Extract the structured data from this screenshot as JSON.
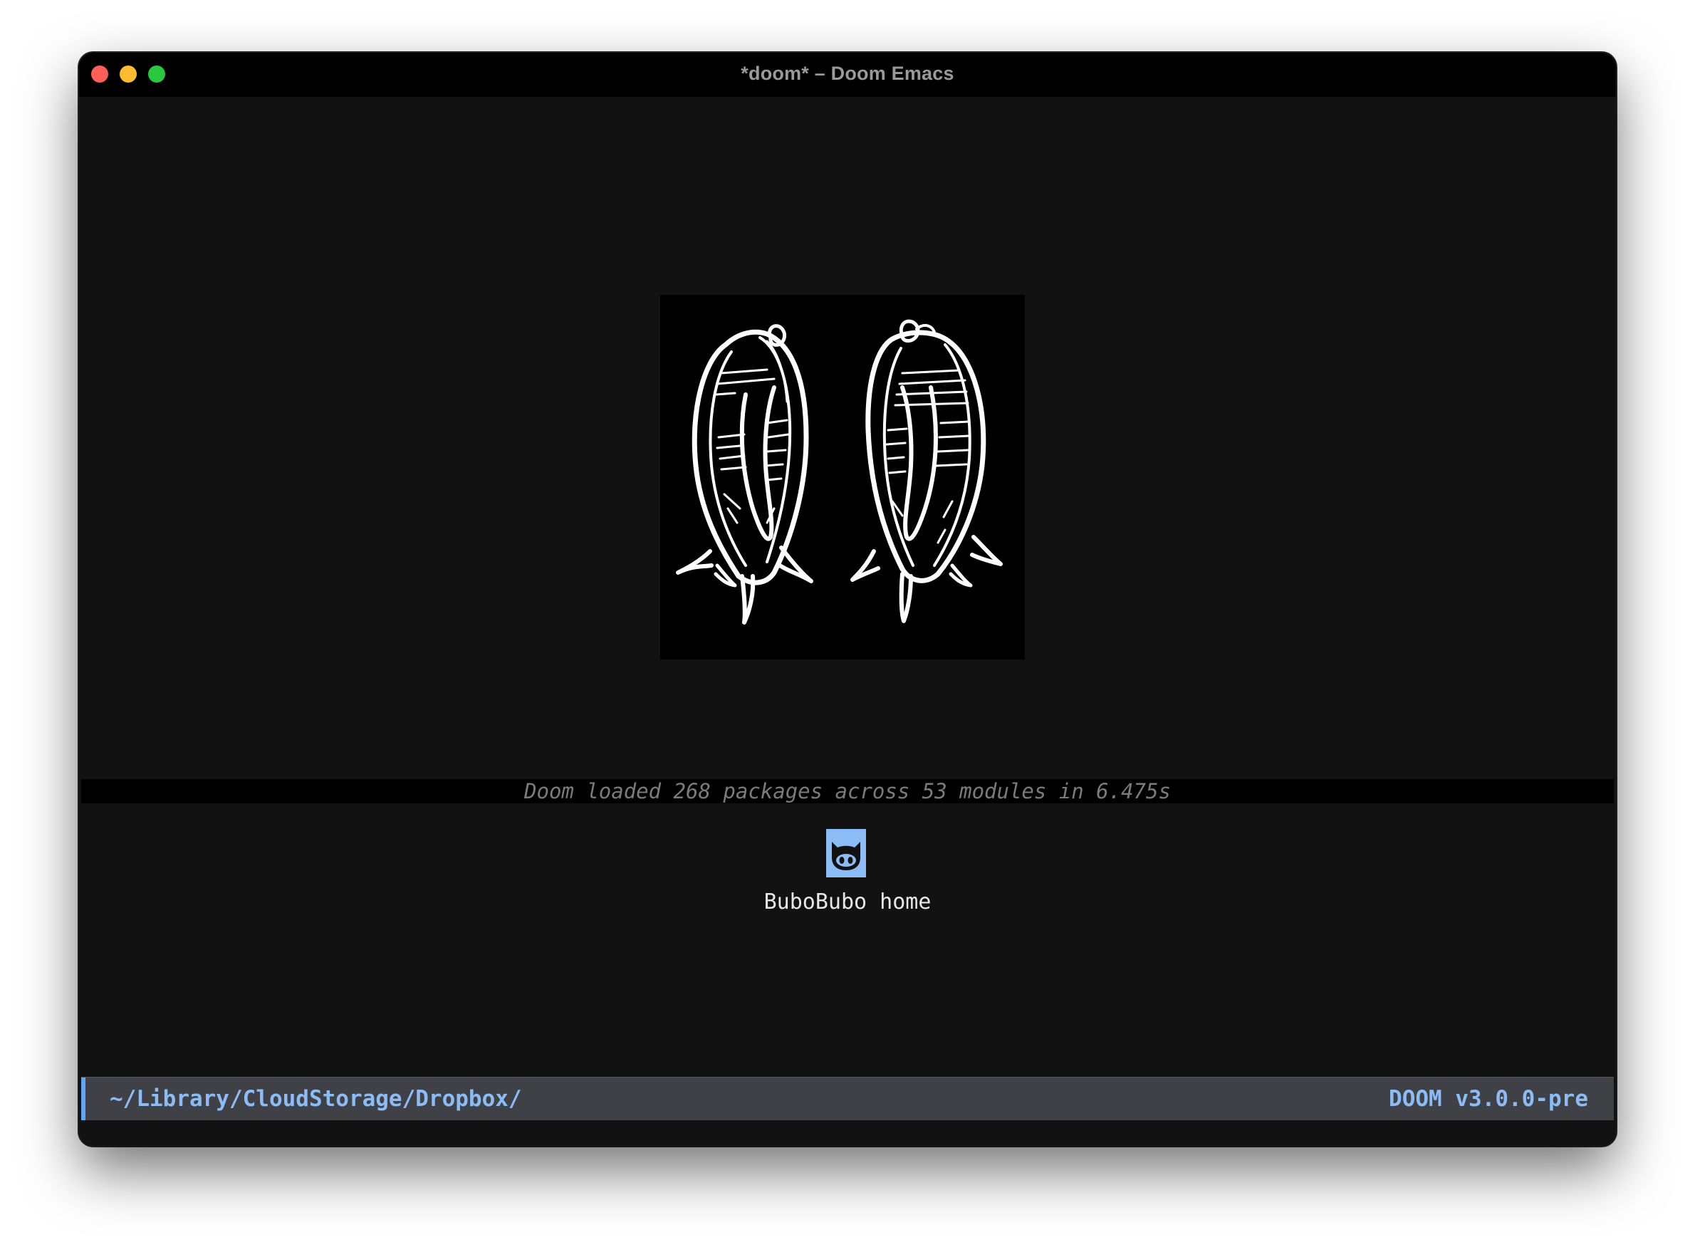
{
  "window": {
    "title": "*doom* – Doom Emacs"
  },
  "dashboard": {
    "banner_icon": "two-fish-sketch-banner",
    "loaded_message": "Doom loaded 268 packages across 53 modules in 6.475s",
    "menu": [
      {
        "label": "BuboBubo home",
        "icon": "octocat-icon"
      }
    ]
  },
  "modeline": {
    "path": "~/Library/CloudStorage/Dropbox/",
    "version": "DOOM v3.0.0-pre"
  },
  "colors": {
    "background": "#121212",
    "modeline": "#3f4146",
    "accent": "#8cbcf5",
    "loaded_text": "#7b7b7b"
  }
}
